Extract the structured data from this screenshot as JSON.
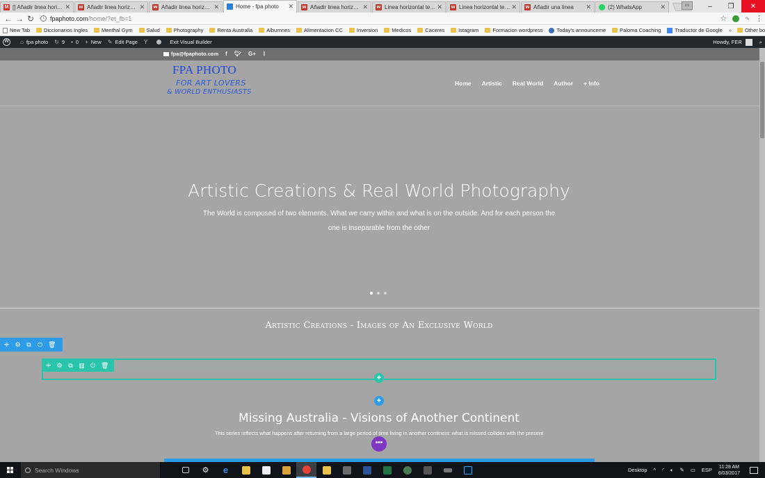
{
  "browser": {
    "tabs": [
      {
        "title": "[] Añadir linea horizontal",
        "favicon": "gmail-icon",
        "active": false
      },
      {
        "title": "Añadir linea horizontal",
        "favicon": "w-icon",
        "active": false
      },
      {
        "title": "Añadir linea horizontal",
        "favicon": "w-icon",
        "active": false
      },
      {
        "title": "Home - fpa photo",
        "favicon": "home-page-icon",
        "active": true
      },
      {
        "title": "Añadir linea horizontal",
        "favicon": "w-icon",
        "active": false
      },
      {
        "title": "Linea horizontal templ.",
        "favicon": "w-icon",
        "active": false
      },
      {
        "title": "Linea horizontal templ.",
        "favicon": "w-icon",
        "active": false
      },
      {
        "title": "Añadir una linea",
        "favicon": "w-icon",
        "active": false
      },
      {
        "title": "(2) WhatsApp",
        "favicon": "whatsapp-icon",
        "active": false
      }
    ],
    "url_host": "fpaphoto.com",
    "url_path": "/home/?et_fb=1",
    "bookmarks": [
      {
        "label": "New Tab",
        "icon": "page"
      },
      {
        "label": "Diccionarios Ingles",
        "icon": "folder"
      },
      {
        "label": "Menthal Gym",
        "icon": "folder"
      },
      {
        "label": "Salud",
        "icon": "folder"
      },
      {
        "label": "Photography",
        "icon": "folder"
      },
      {
        "label": "Renta Australia",
        "icon": "folder"
      },
      {
        "label": "Alburnnes",
        "icon": "folder"
      },
      {
        "label": "Alimentacion CC",
        "icon": "folder"
      },
      {
        "label": "Inversion",
        "icon": "folder"
      },
      {
        "label": "Medicos",
        "icon": "folder"
      },
      {
        "label": "Caceres",
        "icon": "folder"
      },
      {
        "label": "Istagram",
        "icon": "folder"
      },
      {
        "label": "Formacion wordpress",
        "icon": "folder"
      },
      {
        "label": "Today's announceme",
        "icon": "globe"
      },
      {
        "label": "Paloma Coaching",
        "icon": "folder"
      },
      {
        "label": "Traductor de Google",
        "icon": "translate"
      }
    ],
    "bookmarks_chevron": "»",
    "other_bookmarks": "Other bookmarks"
  },
  "wp_admin": {
    "site_name": "fpa photo",
    "updates_count": "9",
    "comments_count": "0",
    "new_label": "New",
    "edit_page_label": "Edit Page",
    "exit_builder_label": "Exit Visual Builder",
    "howdy": "Howdy, FER"
  },
  "site": {
    "email": "fpa@fpaphoto.com",
    "social": [
      "f",
      "t",
      "G+",
      "rss"
    ],
    "logo_title": "FPA PHOTO",
    "logo_tag1": "FOR ART LOVERS",
    "logo_tag2": "& WORLD ENTHUSIASTS",
    "nav": [
      "Home",
      "Artistic",
      "Real World",
      "Author",
      "+ Info"
    ],
    "hero_title": "Artistic Creations & Real World Photography",
    "hero_text": "The World is composed of two elements. What we carry within and what is on the outside. And for each person the one is inseparable from the other",
    "slider_dots": 3,
    "slider_active": 0,
    "section_title": "Artistic Creations - Images of An Exclusive World",
    "subsection_title": "Missing Australia - Visions of Another Continent",
    "subsection_text": "This series reflects what happens after returning from a large period of time living in another continent: what is missed collides with the present"
  },
  "builder": {
    "section_controls": [
      "move-icon",
      "gear-icon",
      "duplicate-icon",
      "power-icon",
      "trash-icon"
    ],
    "row_controls": [
      "move-icon",
      "gear-icon",
      "duplicate-icon",
      "columns-icon",
      "power-icon",
      "trash-icon"
    ],
    "add_row_symbol": "+",
    "add_section_symbol": "+",
    "more_symbol": "•••",
    "colors": {
      "section": "#2e9be6",
      "row": "#29c4a9",
      "more": "#7f36c2"
    }
  },
  "taskbar": {
    "search_placeholder": "Search Windows",
    "desktop_label": "Desktop",
    "language": "ESP",
    "time": "11:28 AM",
    "date": "6/03/2017"
  }
}
